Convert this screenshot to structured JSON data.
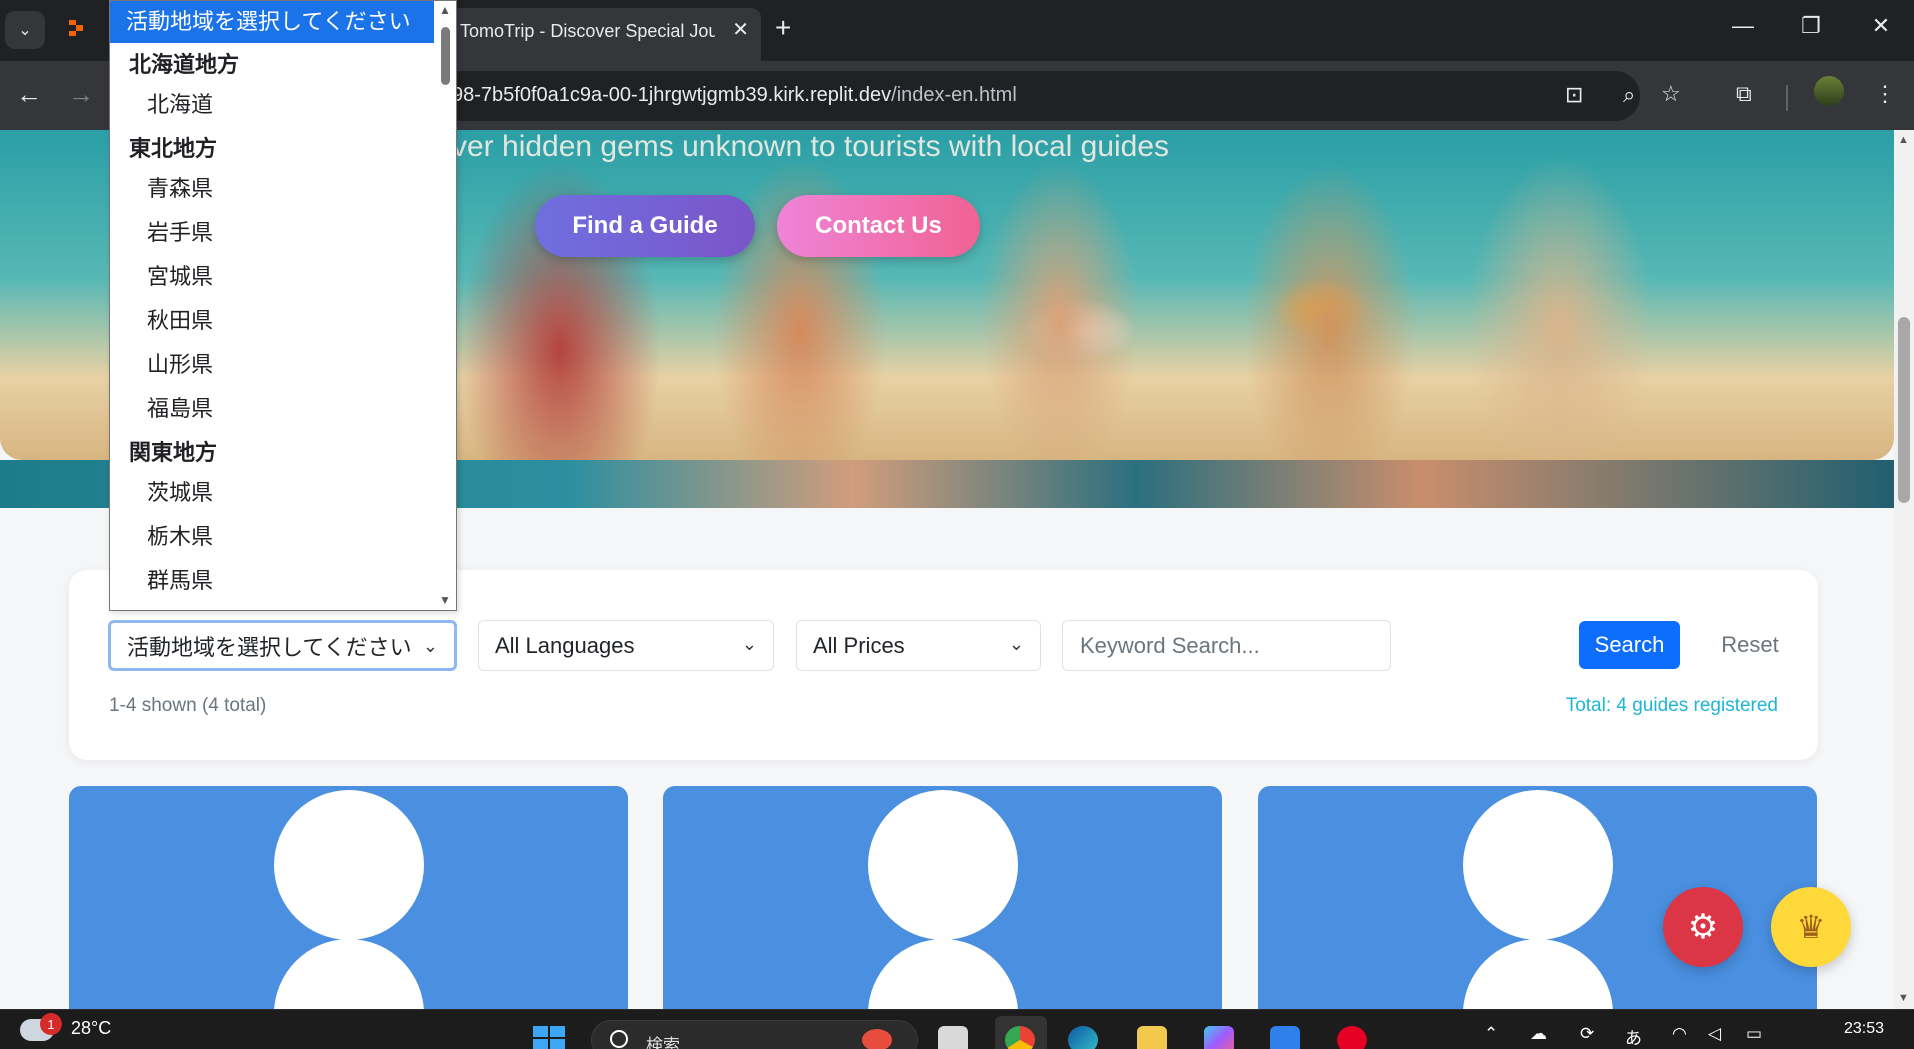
{
  "browser": {
    "active_tab_title": "TomoTrip - Discover Special Journeys",
    "url_prefix": "98-7b5f0f0a1c9a-00-1jhrgwtjgmb39.kirk.replit.dev",
    "url_path": "/index-en.html"
  },
  "hero": {
    "subtitle": "ver hidden gems unknown to tourists with local guides",
    "find_guide_label": "Find a Guide",
    "contact_label": "Contact Us"
  },
  "filters": {
    "region_selected": "活動地域を選択してください",
    "language_selected": "All Languages",
    "price_selected": "All Prices",
    "keyword_placeholder": "Keyword Search...",
    "search_label": "Search",
    "reset_label": "Reset",
    "shown_text": "1-4 shown (4 total)",
    "total_text": "Total: 4 guides registered"
  },
  "dropdown": {
    "selected": "活動地域を選択してください",
    "items": [
      {
        "type": "group",
        "label": "北海道地方"
      },
      {
        "type": "option",
        "label": "北海道"
      },
      {
        "type": "group",
        "label": "東北地方"
      },
      {
        "type": "option",
        "label": "青森県"
      },
      {
        "type": "option",
        "label": "岩手県"
      },
      {
        "type": "option",
        "label": "宮城県"
      },
      {
        "type": "option",
        "label": "秋田県"
      },
      {
        "type": "option",
        "label": "山形県"
      },
      {
        "type": "option",
        "label": "福島県"
      },
      {
        "type": "group",
        "label": "関東地方"
      },
      {
        "type": "option",
        "label": "茨城県"
      },
      {
        "type": "option",
        "label": "栃木県"
      },
      {
        "type": "option",
        "label": "群馬県"
      }
    ]
  },
  "guide_cards_count": 3,
  "taskbar": {
    "weather_temp": "28°C",
    "weather_badge": "1",
    "search_placeholder": "検索",
    "ime_label": "あ",
    "time": "23:53"
  },
  "colors": {
    "primary": "#0d6efd",
    "find_guide_gradient": [
      "#6f6fe0",
      "#7b55c8"
    ],
    "contact_gradient": [
      "#ef84d8",
      "#f06293"
    ],
    "card_bg": "#4a8fe0",
    "total_text": "#1fb5d5",
    "gear_fab": "#dc3545",
    "trophy_fab": "#ffd83a"
  },
  "icons": [
    "tab-search-icon",
    "close-icon",
    "plus-icon",
    "minimize-icon",
    "restore-icon",
    "back-icon",
    "forward-icon",
    "translate-icon",
    "zoom-icon",
    "star-icon",
    "extensions-icon",
    "menu-icon",
    "chevron-down-icon",
    "gear-icon",
    "trophy-icon",
    "search-icon",
    "windows-icon"
  ]
}
